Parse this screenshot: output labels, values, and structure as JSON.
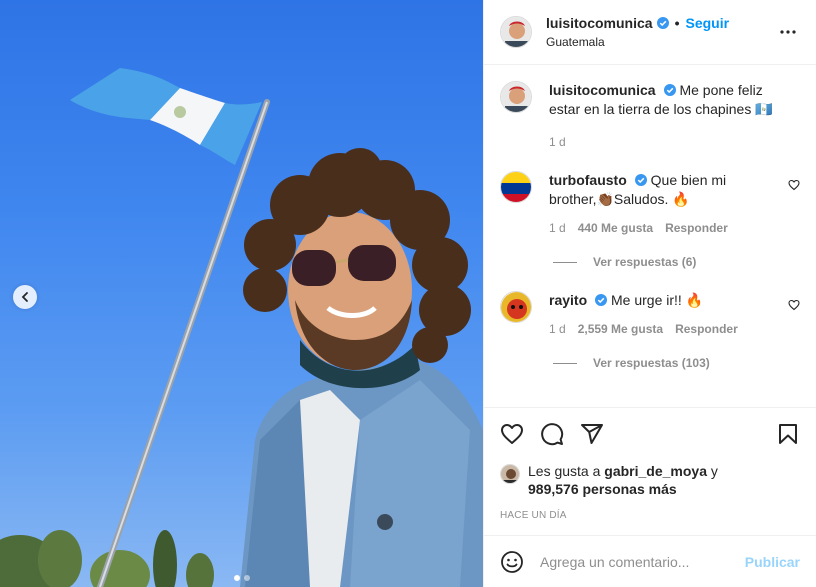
{
  "post": {
    "author": "luisitocomunica",
    "follow_label": "Seguir",
    "separator": "•",
    "location": "Guatemala",
    "caption": "Me pone feliz estar en la tierra de los chapines 🇬🇹",
    "caption_age": "1 d"
  },
  "comments": [
    {
      "user": "turbofausto",
      "text": "Que bien mi brother,👏🏾Saludos. 🔥",
      "age": "1 d",
      "likes": "440 Me gusta",
      "reply_label": "Responder",
      "view_replies": "Ver respuestas (6)"
    },
    {
      "user": "rayito",
      "text": "Me urge ir!! 🔥",
      "age": "1 d",
      "likes": "2,559 Me gusta",
      "reply_label": "Responder",
      "view_replies": "Ver respuestas (103)"
    }
  ],
  "likes_summary": {
    "prefix": "Les gusta a",
    "user": "gabri_de_moya",
    "conj": "y",
    "count": "989,576 personas más"
  },
  "timestamp": "HACE UN DÍA",
  "add_comment": {
    "placeholder": "Agrega un comentario...",
    "publish_label": "Publicar"
  },
  "colors": {
    "accent": "#0095f6",
    "verified": "#3897f0",
    "secondary_text": "#8e8e8e"
  },
  "carousel": {
    "current": 1,
    "total": 2
  }
}
